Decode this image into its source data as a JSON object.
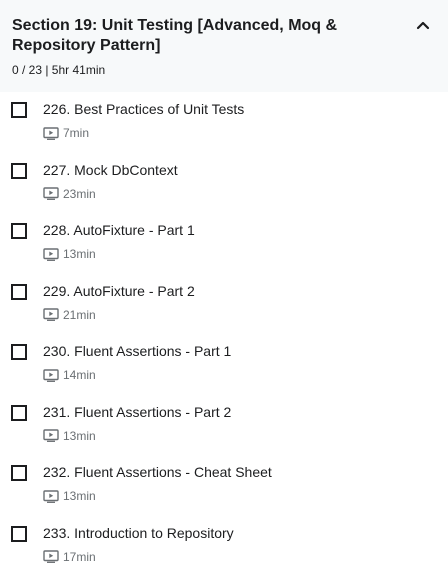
{
  "section": {
    "title": "Section 19: Unit Testing [Advanced, Moq & Repository Pattern]",
    "meta": "0 / 23 | 5hr 41min",
    "collapse_icon": "chevron-up-icon"
  },
  "lectures": [
    {
      "title": "226. Best Practices of Unit Tests",
      "duration": "7min",
      "icon": "video-icon",
      "completed": false
    },
    {
      "title": "227. Mock DbContext",
      "duration": "23min",
      "icon": "video-icon",
      "completed": false
    },
    {
      "title": "228. AutoFixture - Part 1",
      "duration": "13min",
      "icon": "video-icon",
      "completed": false
    },
    {
      "title": "229. AutoFixture - Part 2",
      "duration": "21min",
      "icon": "video-icon",
      "completed": false
    },
    {
      "title": "230. Fluent Assertions - Part 1",
      "duration": "14min",
      "icon": "video-icon",
      "completed": false
    },
    {
      "title": "231. Fluent Assertions - Part 2",
      "duration": "13min",
      "icon": "video-icon",
      "completed": false
    },
    {
      "title": "232. Fluent Assertions - Cheat Sheet",
      "duration": "13min",
      "icon": "video-icon",
      "completed": false
    },
    {
      "title": "233. Introduction to Repository",
      "duration": "17min",
      "icon": "video-icon",
      "completed": false
    }
  ],
  "colors": {
    "header_bg": "#f7f9fa",
    "text": "#1c1d1f",
    "meta_text": "#6a6f73"
  }
}
